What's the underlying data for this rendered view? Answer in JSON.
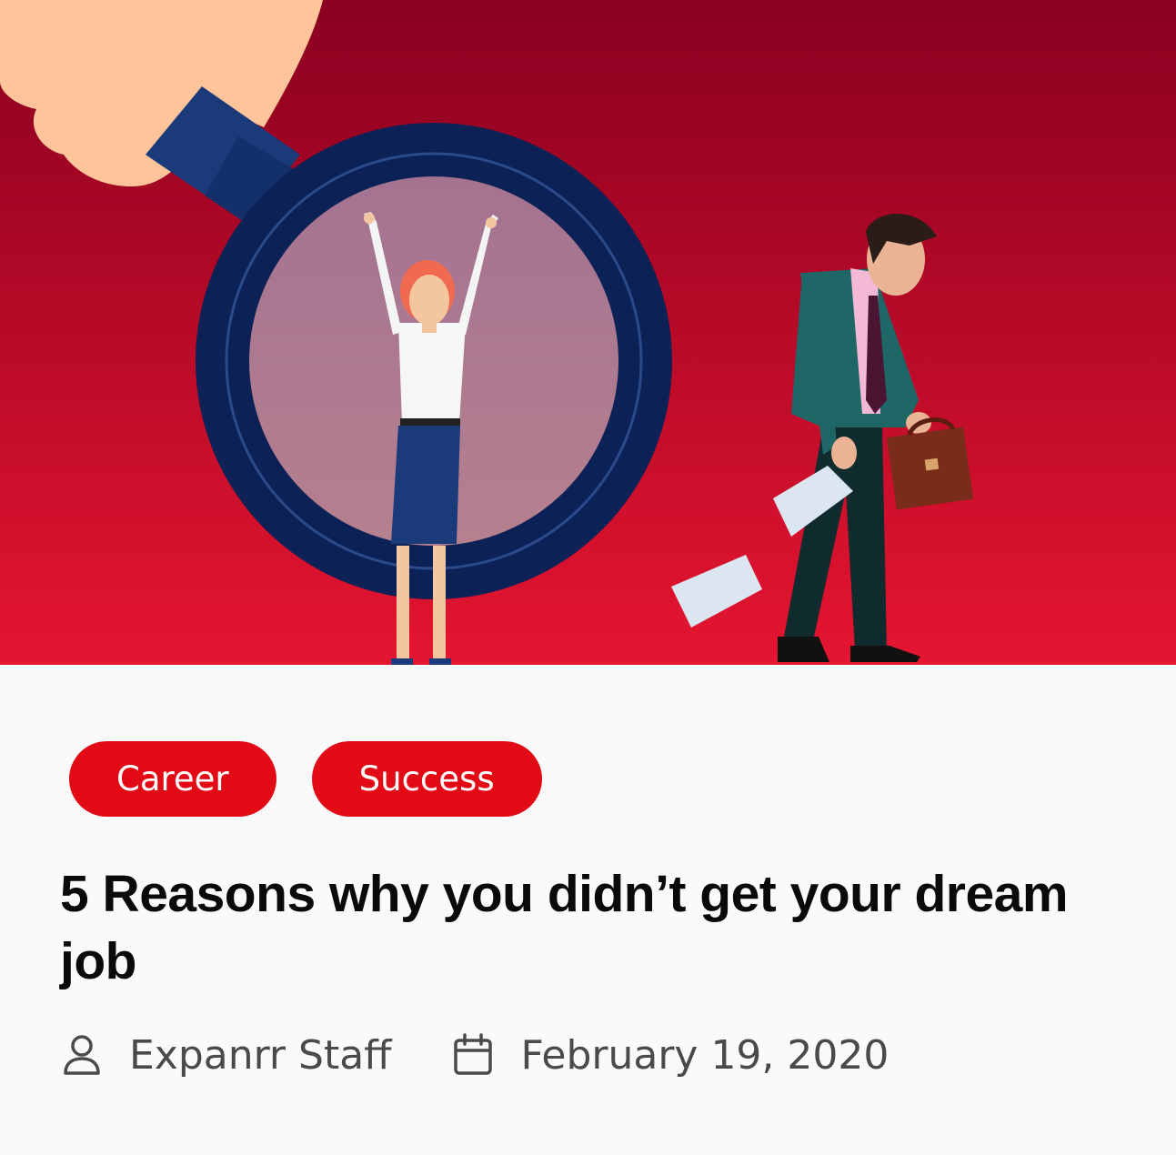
{
  "article": {
    "image_description_icon": "hero-illustration",
    "tags": [
      "Career",
      "Success"
    ],
    "title": "5 Reasons why you didn’t get your dream job",
    "author": "Expanrr Staff",
    "date": "February 19, 2020"
  },
  "icons": {
    "author": "person-icon",
    "date": "calendar-icon"
  },
  "colors": {
    "tag_background": "#e20b15",
    "tag_text": "#ffffff",
    "title_text": "#0a0a0a",
    "meta_text": "#4a4a4a",
    "hero_top": "#8a0020",
    "hero_bottom": "#e51530",
    "card_background": "#fafafa"
  }
}
